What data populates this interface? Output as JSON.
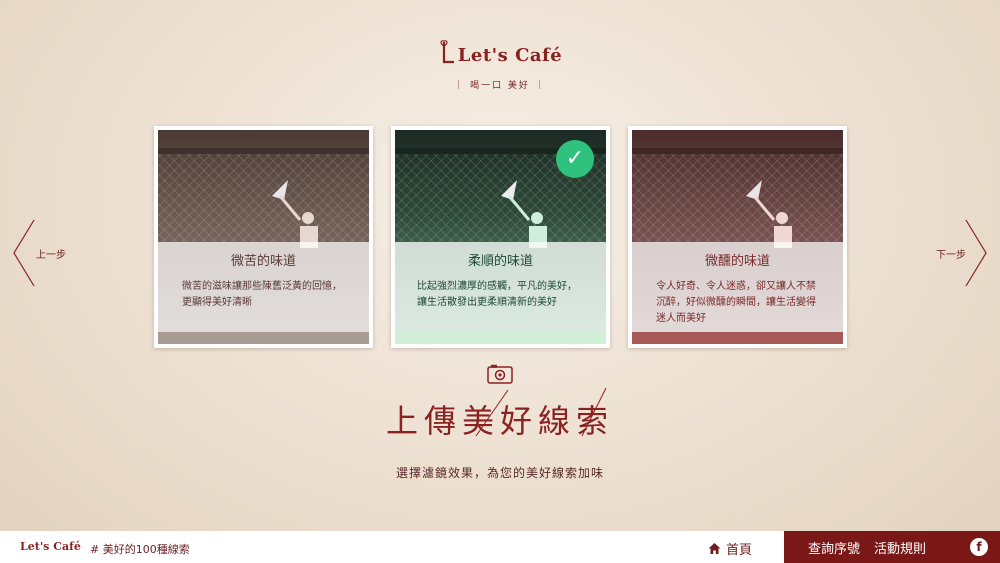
{
  "logo": {
    "text": "Let's Café",
    "slogan": "｜ 喝一口 美好 ｜"
  },
  "nav": {
    "prev_label": "上一步",
    "next_label": "下一步"
  },
  "cards": [
    {
      "title": "微苦的味道",
      "desc": "微苦的滋味讓那些陳舊泛黃的回憶，更顯得美好清晰",
      "selected": false
    },
    {
      "title": "柔順的味道",
      "desc": "比起強烈濃厚的感觸，平凡的美好，讓生活散發出更柔順清新的美好",
      "selected": true,
      "badge": "✓"
    },
    {
      "title": "微醺的味道",
      "desc": "令人好奇、令人迷惑，卻又讓人不禁沉醉，好似微醺的瞬間，讓生活變得迷人而美好",
      "selected": false
    }
  ],
  "heading": "上傳美好線索",
  "subtitle": "選擇濾鏡效果，為您的美好線索加味",
  "icons": {
    "camera": "camera-icon",
    "home": "home-icon",
    "facebook": "facebook-icon",
    "check": "check-icon"
  },
  "footer": {
    "logo": "Let's Café",
    "hashtag": "# 美好的100種線索",
    "home_label": "首頁",
    "lookup_label": "查詢序號",
    "rules_label": "活動規則",
    "fb": "f"
  },
  "colors": {
    "brand": "#7a1818",
    "check": "#2ec27e"
  }
}
